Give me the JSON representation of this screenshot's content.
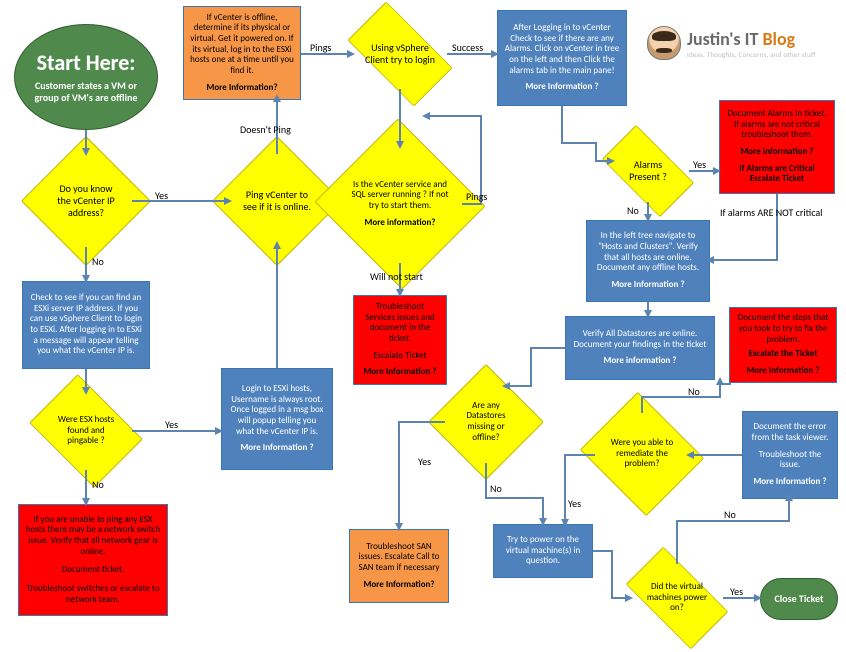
{
  "chart_data": {
    "type": "flowchart",
    "title": "Customer states a VM or group of VM's are offline — troubleshooting flow",
    "nodes": [
      {
        "id": "start",
        "shape": "terminator",
        "color": "green",
        "title": "Start Here:",
        "text": "Customer states a VM or group of VM's are offline"
      },
      {
        "id": "d1",
        "shape": "decision",
        "color": "yellow",
        "text": "Do you know the vCenter IP address?"
      },
      {
        "id": "d2",
        "shape": "decision",
        "color": "yellow",
        "text": "Ping vCenter to see if it is online."
      },
      {
        "id": "p_vcoff",
        "shape": "process",
        "color": "orange",
        "text": "If vCenter is offline, determine if its physical or virtual. Get it powered on. If its virtual, log in to the ESXi hosts one at a time until you find it.",
        "more": "More Information?"
      },
      {
        "id": "d3",
        "shape": "decision",
        "color": "yellow",
        "text": "Using vSphere Client try to login"
      },
      {
        "id": "d4",
        "shape": "decision",
        "color": "yellow",
        "text": "Is the vCenter service and SQL server running ? If not try to start them.",
        "more": "More information?"
      },
      {
        "id": "p_svc",
        "shape": "process",
        "color": "red",
        "text": "Troubleshoot Services issues and document in the ticket. | Escalate Ticket",
        "more": "More Information ?"
      },
      {
        "id": "p_alarmscheck",
        "shape": "process",
        "color": "blue",
        "text": "After Logging in to vCenter Check to see if there are any Alarms. Click on vCenter in tree on the left and then Click the alarms tab in the main pane!",
        "more": "More Information ?"
      },
      {
        "id": "d5",
        "shape": "decision",
        "color": "yellow",
        "text": "Alarms Present ?"
      },
      {
        "id": "p_docalarms",
        "shape": "process",
        "color": "red",
        "text": "Document Alarms In ticket. If alarms are not critical troubleshoot them. | If Alarms are Critical Escalate Ticket",
        "more": "More Information ?"
      },
      {
        "id": "p_hosts",
        "shape": "process",
        "color": "blue",
        "text": "In the left tree navigate to \"Hosts and Clusters\". Verify that all hosts are online. Document any offline hosts.",
        "more": "More Information ?"
      },
      {
        "id": "p_ds",
        "shape": "process",
        "color": "blue",
        "text": "Verify All Datastores are online. Document your findings in the ticket",
        "more": "More information ?"
      },
      {
        "id": "d6",
        "shape": "decision",
        "color": "yellow",
        "text": "Are any Datastores missing or offline?"
      },
      {
        "id": "p_san",
        "shape": "process",
        "color": "orange",
        "text": "Troubleshoot SAN issues. Escalate Call to SAN team if necessary",
        "more": "More Information?"
      },
      {
        "id": "p_power",
        "shape": "process",
        "color": "blue",
        "text": "Try to power on the virtual machine(s) in question."
      },
      {
        "id": "d7",
        "shape": "decision",
        "color": "yellow",
        "text": "Did the virtual machines power on?"
      },
      {
        "id": "end",
        "shape": "terminator",
        "color": "green",
        "text": "Close Ticket"
      },
      {
        "id": "p_taskerr",
        "shape": "process",
        "color": "blue",
        "text": "Document the error from the task viewer. | Troubleshoot the issue.",
        "more": "More Information ?"
      },
      {
        "id": "d8",
        "shape": "decision",
        "color": "yellow",
        "text": "Were you able to remediate the problem?"
      },
      {
        "id": "p_steps",
        "shape": "process",
        "color": "red",
        "text": "Document the steps that you took to try to fix the problem. | Escalate the Ticket",
        "more": "More Information ?"
      },
      {
        "id": "p_findip",
        "shape": "process",
        "color": "blue",
        "text": "Check to see if you can find an ESXi server IP address. If you can use vSphere Client to login to ESXi. After logging in to ESXi a message will appear telling you what the vCenter IP is."
      },
      {
        "id": "d9",
        "shape": "decision",
        "color": "yellow",
        "text": "Were ESX hosts found and pingable ?"
      },
      {
        "id": "p_loginesxi",
        "shape": "process",
        "color": "blue",
        "text": "Login to ESXi hosts, Username is always root. Once logged in a msg box will popup telling you what the vCenter IP is.",
        "more": "More Information ?"
      },
      {
        "id": "p_network",
        "shape": "process",
        "color": "red",
        "text": "If you are unable to ping any ESX hosts there may be a network switch issue. Verify that all network gear is online. | Document ticket. | Troubleshoot switches or escalate to network team."
      }
    ],
    "edges": [
      {
        "from": "start",
        "to": "d1"
      },
      {
        "from": "d1",
        "to": "d2",
        "label": "Yes"
      },
      {
        "from": "d1",
        "to": "p_findip",
        "label": "No"
      },
      {
        "from": "d2",
        "to": "p_vcoff",
        "label": "Doesn't Ping"
      },
      {
        "from": "d2",
        "to": "d3",
        "label": "Pings"
      },
      {
        "from": "p_vcoff",
        "to": "d3",
        "label": "Pings"
      },
      {
        "from": "d3",
        "to": "p_alarmscheck",
        "label": "Success"
      },
      {
        "from": "d3",
        "to": "d4"
      },
      {
        "from": "d4",
        "to": "p_svc",
        "label": "Will not start"
      },
      {
        "from": "d4",
        "to": "d3",
        "label": "Pings"
      },
      {
        "from": "p_alarmscheck",
        "to": "d5"
      },
      {
        "from": "d5",
        "to": "p_docalarms",
        "label": "Yes"
      },
      {
        "from": "d5",
        "to": "p_hosts",
        "label": "No"
      },
      {
        "from": "p_docalarms",
        "to": "p_hosts",
        "label": "If alarms ARE NOT critical"
      },
      {
        "from": "p_hosts",
        "to": "p_ds"
      },
      {
        "from": "p_ds",
        "to": "d6"
      },
      {
        "from": "d6",
        "to": "p_san",
        "label": "Yes"
      },
      {
        "from": "d6",
        "to": "p_power",
        "label": "No"
      },
      {
        "from": "p_power",
        "to": "d7"
      },
      {
        "from": "d7",
        "to": "end",
        "label": "Yes"
      },
      {
        "from": "d7",
        "to": "p_taskerr",
        "label": "No"
      },
      {
        "from": "p_taskerr",
        "to": "d8"
      },
      {
        "from": "d8",
        "to": "p_power",
        "label": "Yes"
      },
      {
        "from": "d8",
        "to": "p_steps",
        "label": "No"
      },
      {
        "from": "p_findip",
        "to": "d9"
      },
      {
        "from": "d9",
        "to": "p_loginesxi",
        "label": "Yes"
      },
      {
        "from": "d9",
        "to": "p_network",
        "label": "No"
      },
      {
        "from": "p_loginesxi",
        "to": "d2"
      }
    ]
  },
  "logo_main": "Justin's IT",
  "logo_accent": "Blog",
  "logo_sub": "Ideas, Thoughts, Concerns, and other stuff",
  "n": {
    "start_t": "Start Here:",
    "start_s": "Customer states a VM or group of VM's are offline",
    "d1": "Do you know the vCenter IP address?",
    "d2": "Ping vCenter to see if it is online.",
    "vcoff": "If vCenter is offline, determine if its physical or virtual. Get it powered on. If its virtual, log in to the ESXi hosts one at a time until you find it.",
    "vcoff_m": "More Information?",
    "d3": "Using vSphere Client try to login",
    "d4": "Is the vCenter service and SQL server running ? If not try to start them.",
    "d4_m": "More information?",
    "svc1": "Troubleshoot Services issues and document in the ticket.",
    "svc2": "Escalate Ticket",
    "svc_m": "More Information ?",
    "alarmscheck": "After Logging in to vCenter Check to see if there are any Alarms. Click on vCenter in tree on the left and then Click the alarms tab in the main pane!",
    "alarmscheck_m": "More Information ?",
    "d5": "Alarms Present ?",
    "docal1": "Document Alarms In ticket. If alarms are not critical troubleshoot them.",
    "docal_m1": "More Information ?",
    "docal2": "If Alarms are Critical Escalate Ticket",
    "hosts": "In the left tree navigate to \"Hosts and Clusters\". Verify that all hosts are online. Document any offline hosts.",
    "hosts_m": "More Information ?",
    "ds": "Verify All Datastores are online. Document your findings in the ticket",
    "ds_m": "More information ?",
    "d6": "Are any Datastores missing or offline?",
    "san": "Troubleshoot SAN issues. Escalate Call to SAN team if necessary",
    "san_m": "More Information?",
    "power": "Try to power on the virtual machine(s) in question.",
    "d7": "Did the virtual machines power on?",
    "end": "Close Ticket",
    "taskerr1": "Document the error from the task viewer.",
    "taskerr2": "Troubleshoot the issue.",
    "taskerr_m": "More Information ?",
    "d8": "Were you able to remediate the problem?",
    "steps1": "Document the steps that you took to try to fix the problem.",
    "steps2": "Escalate the Ticket",
    "steps_m": "More Information ?",
    "findip": "Check to see if you can find an ESXi server IP address. If you can use vSphere Client to login to ESXi. After logging in to ESXi a message will appear telling you what the vCenter IP is.",
    "d9": "Were ESX hosts found and pingable ?",
    "loginesxi": "Login to ESXi hosts, Username is always root.\nOnce logged in a msg box will popup telling you what the vCenter IP is.",
    "loginesxi_m": "More Information ?",
    "net1": "If you are unable to ping any ESX hosts there may be a network switch issue. Verify that all network gear is online.",
    "net2": "Document ticket.",
    "net3": "Troubleshoot switches or escalate to network team."
  },
  "l": {
    "yes": "Yes",
    "no": "No",
    "dping": "Doesn't Ping",
    "pings": "Pings",
    "success": "Success",
    "wns": "Will not start",
    "notcrit": "If alarms ARE NOT critical"
  }
}
